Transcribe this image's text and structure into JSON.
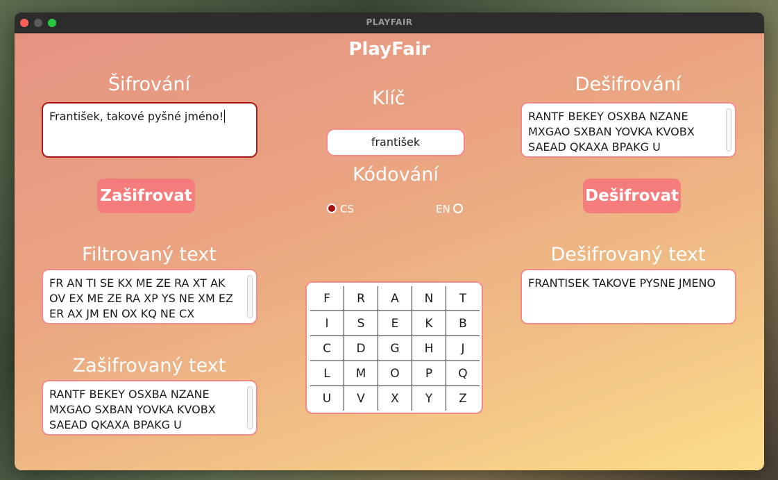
{
  "window": {
    "title": "PLAYFAIR"
  },
  "app": {
    "title": "PlayFair"
  },
  "encrypt": {
    "heading": "Šifrování",
    "input_value": "František, takové pyšné jméno!",
    "button_label": "Zašifrovat"
  },
  "key": {
    "heading": "Klíč",
    "value": "františek"
  },
  "encoding": {
    "heading": "Kódování",
    "options": [
      {
        "label": "CS",
        "selected": true
      },
      {
        "label": "EN",
        "selected": false
      }
    ]
  },
  "decrypt": {
    "heading": "Dešifrování",
    "input_value": "RANTF BEKEY OSXBA NZANE MXGAO SXBAN YOVKA KVOBX SAEAD QKAXA BPAKG U",
    "button_label": "Dešifrovat"
  },
  "filtered": {
    "heading": "Filtrovaný text",
    "value": "FR AN TI SE KX ME ZE RA XT AK OV EX ME ZE RA XP YS NE XM EZ ER AX JM EN OX KQ NE CX"
  },
  "encrypted": {
    "heading": "Zašifrovaný text",
    "value": "RANTF BEKEY OSXBA NZANE MXGAO SXBAN YOVKA KVOBX SAEAD QKAXA BPAKG U"
  },
  "decrypted": {
    "heading": "Dešifrovaný text",
    "value": "FRANTISEK TAKOVE PYSNE JMENO"
  },
  "grid": [
    [
      "F",
      "R",
      "A",
      "N",
      "T"
    ],
    [
      "I",
      "S",
      "E",
      "K",
      "B"
    ],
    [
      "C",
      "D",
      "G",
      "H",
      "J"
    ],
    [
      "L",
      "M",
      "O",
      "P",
      "Q"
    ],
    [
      "U",
      "V",
      "X",
      "Y",
      "Z"
    ]
  ],
  "colors": {
    "accent": "#f47c7c",
    "border": "#f38a8a",
    "active_border": "#b01515",
    "radio_selected": "#a81010"
  }
}
